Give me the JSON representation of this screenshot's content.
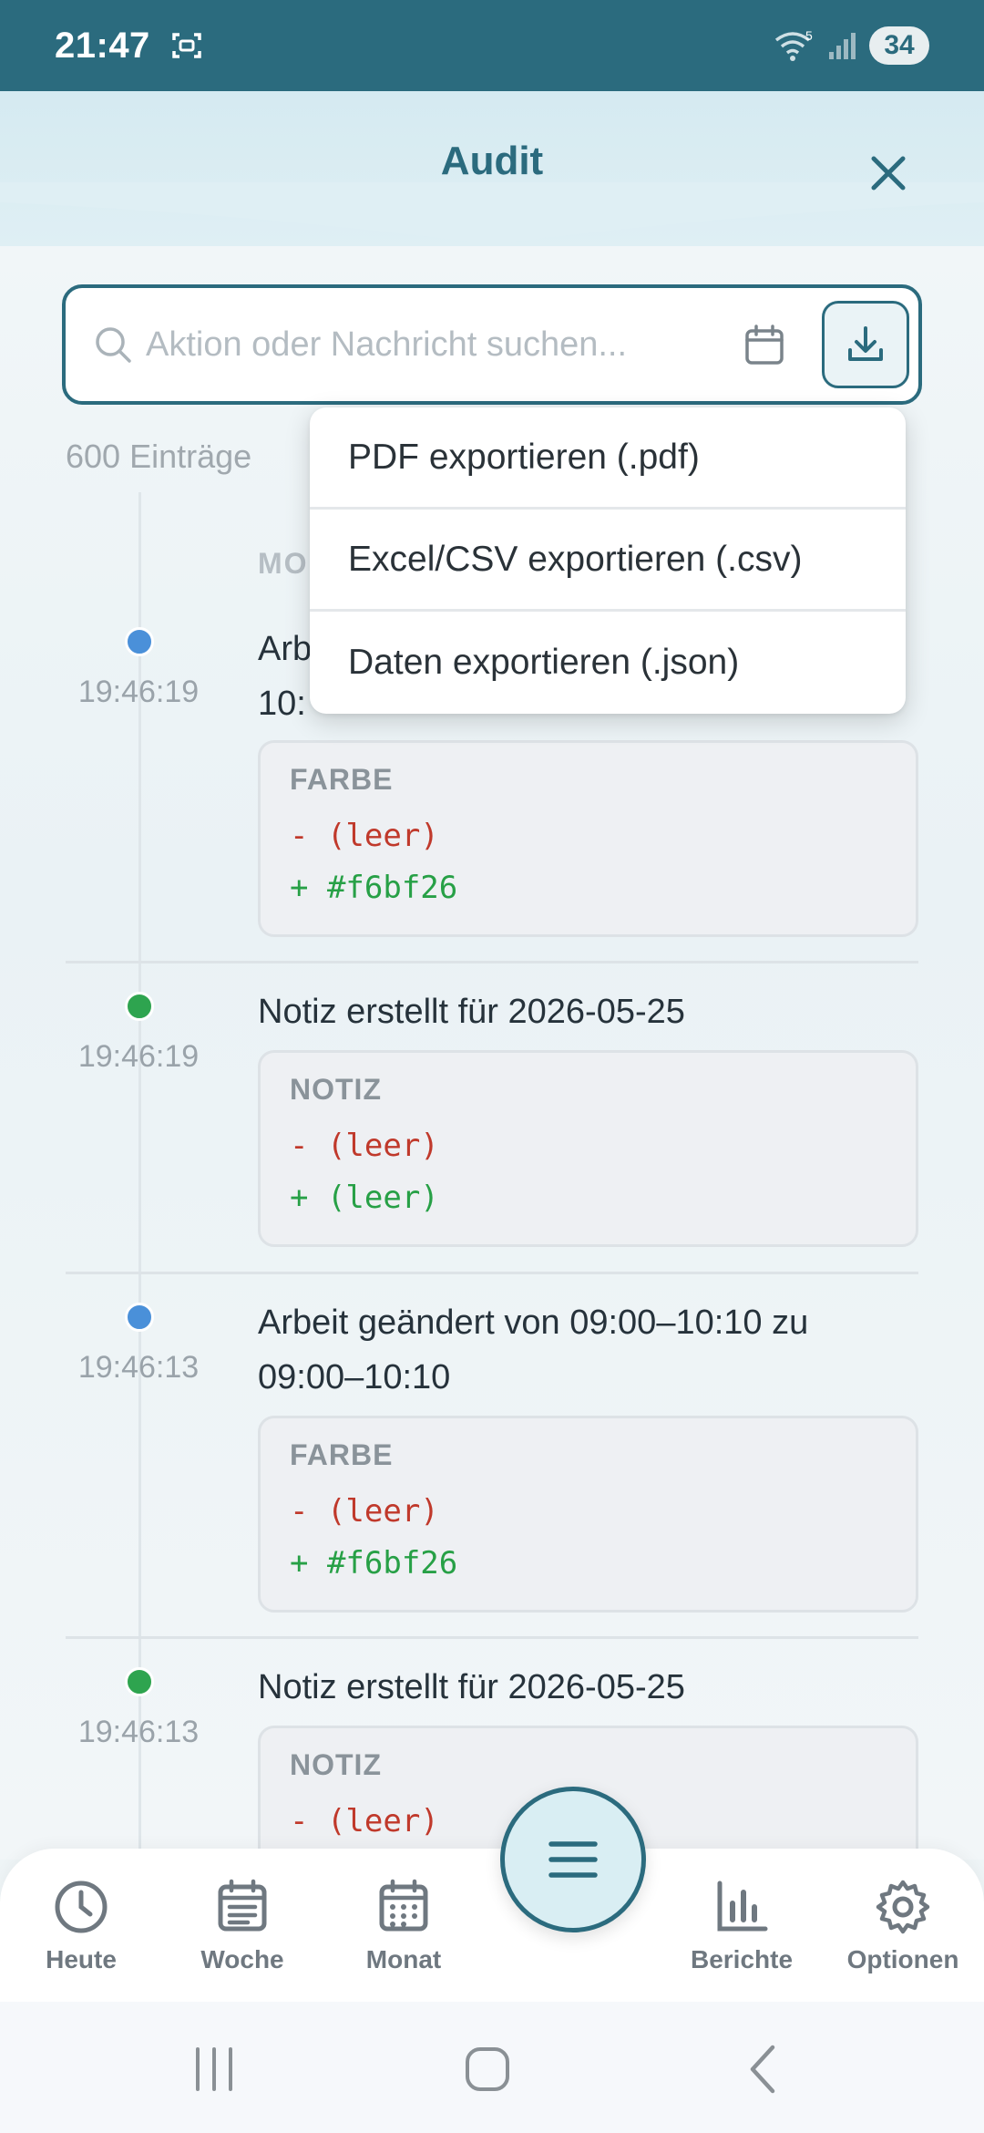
{
  "status_bar": {
    "time": "21:47",
    "battery": "34",
    "wifi_label": "5"
  },
  "header": {
    "title": "Audit"
  },
  "search": {
    "placeholder": "Aktion oder Nachricht suchen..."
  },
  "entry_count": "600 Einträge",
  "date_heading": "MO",
  "export_menu": {
    "items": [
      "PDF exportieren (.pdf)",
      "Excel/CSV exportieren (.csv)",
      "Daten exportieren (.json)"
    ]
  },
  "entries": [
    {
      "time": "19:46:19",
      "color": "#4a90d9",
      "title_line1": "Arb",
      "title_line2": "10:",
      "field": "FARBE",
      "old": "- (leer)",
      "new": "+ #f6bf26"
    },
    {
      "time": "19:46:19",
      "color": "#2ea44f",
      "title_line1": "Notiz erstellt für 2026-05-25",
      "field": "NOTIZ",
      "old": "- (leer)",
      "new": "+ (leer)"
    },
    {
      "time": "19:46:13",
      "color": "#4a90d9",
      "title_line1": "Arbeit geändert von 09:00–10:10 zu",
      "title_line2": "09:00–10:10",
      "field": "FARBE",
      "old": "- (leer)",
      "new": "+ #f6bf26"
    },
    {
      "time": "19:46:13",
      "color": "#2ea44f",
      "title_line1": "Notiz erstellt für 2026-05-25",
      "field": "NOTIZ",
      "old": "- (leer)"
    }
  ],
  "bottom_nav": {
    "items": [
      {
        "label": "Heute",
        "icon": "clock-icon"
      },
      {
        "label": "Woche",
        "icon": "calendar-week-icon"
      },
      {
        "label": "Monat",
        "icon": "calendar-month-icon"
      },
      {
        "label": "Berichte",
        "icon": "bar-chart-icon"
      },
      {
        "label": "Optionen",
        "icon": "gear-icon"
      }
    ],
    "fab_icon": "menu-icon"
  },
  "colors": {
    "primary": "#2b6b7e",
    "blue_dot": "#4a90d9",
    "green_dot": "#2ea44f",
    "diff_old": "#c0392b",
    "diff_new": "#27a046"
  }
}
